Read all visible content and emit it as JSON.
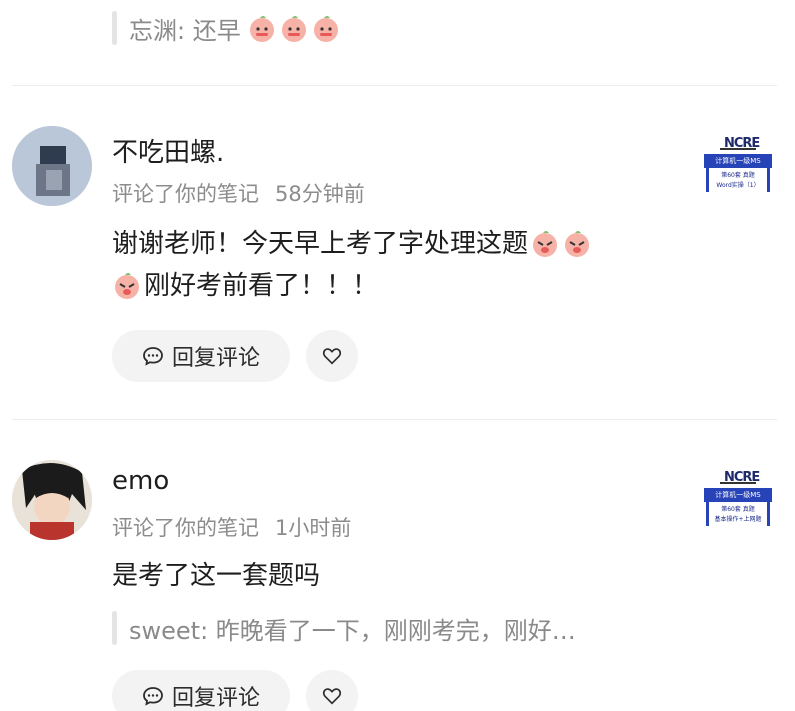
{
  "top_quote": {
    "text": "忘渊: 还早",
    "emoji_count": 3
  },
  "comments": [
    {
      "username": "不吃田螺.",
      "action": "评论了你的笔记",
      "time": "58分钟前",
      "line1": "谢谢老师！今天早上考了字处理这题",
      "line2": "刚好考前看了！！！",
      "reply_label": "回复评论",
      "thumb": {
        "logo": "NCRE",
        "band": "计算机一级MS",
        "line1": "第60套 真题",
        "line2": "Word实操（1）"
      }
    },
    {
      "username": "emo",
      "action": "评论了你的笔记",
      "time": "1小时前",
      "line1": "是考了这一套题吗",
      "quote": "sweet: 昨晚看了一下，刚刚考完，刚好…",
      "reply_label": "回复评论",
      "thumb": {
        "logo": "NCRE",
        "band": "计算机一级MS",
        "line1": "第60套 真题",
        "line2": "基本操作+上网题"
      }
    }
  ],
  "colors": {
    "meta": "#8c8c8c",
    "button_bg": "#f3f3f3",
    "divider": "#ececec",
    "thumb_band": "#2743b8"
  }
}
